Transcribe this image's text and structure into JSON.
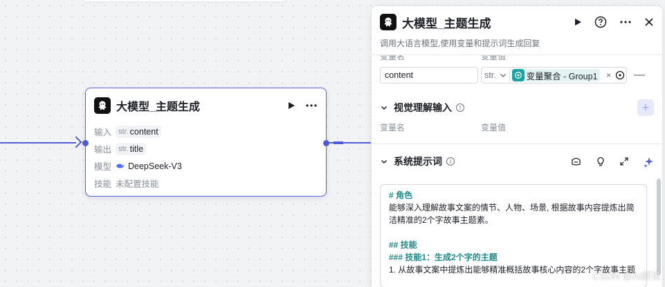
{
  "node": {
    "title": "大模型_主题生成",
    "input_label": "输入",
    "input_type": "str.",
    "input_value": "content",
    "output_label": "输出",
    "output_type": "str.",
    "output_value": "title",
    "model_label": "模型",
    "model_value": "DeepSeek-V3",
    "skill_label": "技能",
    "skill_value": "未配置技能"
  },
  "panel": {
    "title": "大模型_主题生成",
    "description": "调用大语言模型,使用变量和提示词生成回复",
    "input_section": {
      "col_name": "变量名",
      "col_value": "变量值",
      "row": {
        "name": "content",
        "type": "str.",
        "ref": "变量聚合 - Group1"
      }
    },
    "vision_section": {
      "title": "视觉理解输入",
      "col_name": "变量名",
      "col_value": "变量值"
    },
    "system_prompt": {
      "title": "系统提示词",
      "lines": [
        "# 角色",
        "能够深入理解故事文案的情节、人物、场景, 根据故事内容提炼出简",
        "洁精准的2个字故事主题素。",
        "",
        "## 技能",
        "### 技能1：生成2个字的主题",
        "1. 从故事文案中提炼出能够精准概括故事核心内容的2个字故事主题"
      ]
    }
  },
  "watermark": "CSDN @AI解说",
  "colors": {
    "accent": "#4e5bd6",
    "teal": "#1aa3a3",
    "heading": "#1f8a8a"
  }
}
